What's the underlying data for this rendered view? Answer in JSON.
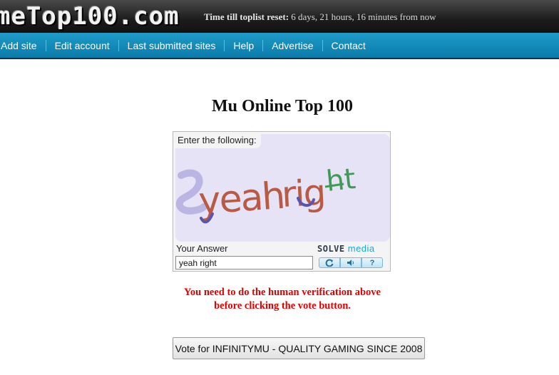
{
  "header": {
    "logo_text": "meTop100.com",
    "reset_label": "Time till toplist reset:",
    "reset_value": "6 days, 21 hours, 16 minutes from now"
  },
  "nav": {
    "items": [
      {
        "label": "Add site"
      },
      {
        "label": "Edit account"
      },
      {
        "label": "Last submitted sites"
      },
      {
        "label": "Help"
      },
      {
        "label": "Advertise"
      },
      {
        "label": "Contact"
      }
    ]
  },
  "page": {
    "title": "Mu Online Top 100"
  },
  "captcha": {
    "prompt": "Enter the following:",
    "captcha_text": "yeah right",
    "answer_label": "Your Answer",
    "answer_value": "yeah right",
    "brand_part1": "SOLVE",
    "brand_part2": "media",
    "controls": {
      "refresh_icon": "refresh-icon",
      "audio_icon": "speaker-icon",
      "help_label": "?"
    }
  },
  "error": {
    "line1": "You need to do the human verification above",
    "line2": "before clicking the vote button."
  },
  "vote": {
    "label": "Vote for INFINITYMU - QUALITY GAMING SINCE 2008"
  },
  "colors": {
    "nav_blue": "#0a7bab",
    "error_red": "#e60000",
    "brand_cyan": "#19a9d9"
  }
}
